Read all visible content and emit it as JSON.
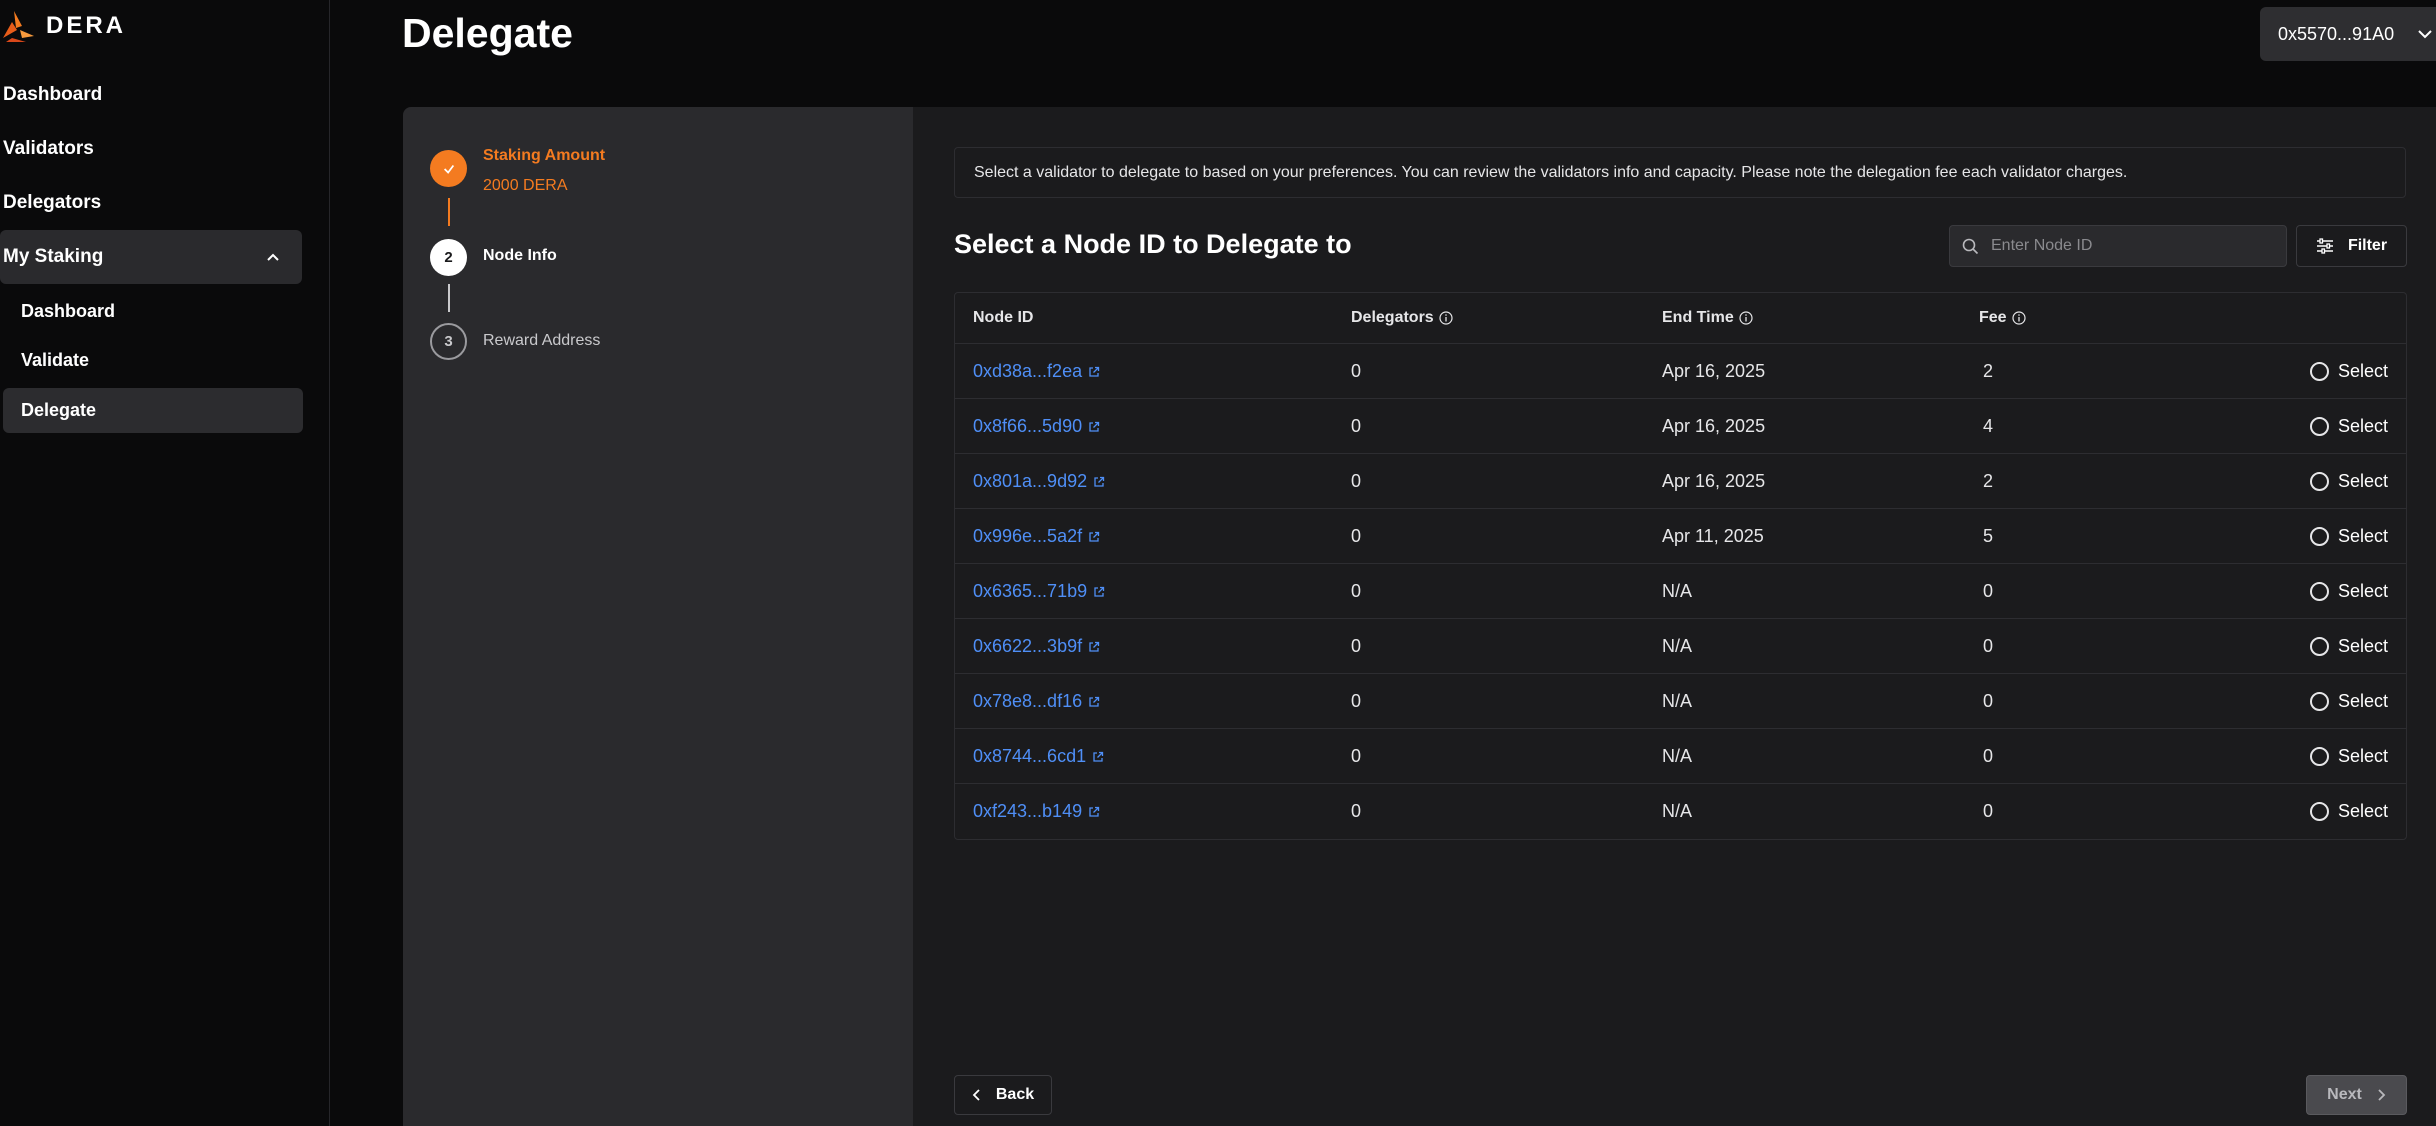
{
  "brand": {
    "name": "DERA",
    "accent": "#f47b20",
    "link_color": "#4f8ff7"
  },
  "sidebar": {
    "items": [
      {
        "label": "Dashboard"
      },
      {
        "label": "Validators"
      },
      {
        "label": "Delegators"
      },
      {
        "label": "My Staking"
      }
    ],
    "sub_items": [
      {
        "label": "Dashboard"
      },
      {
        "label": "Validate"
      },
      {
        "label": "Delegate"
      }
    ]
  },
  "header": {
    "title": "Delegate",
    "wallet": "0x5570...91A0"
  },
  "steps": [
    {
      "number": "",
      "title": "Staking Amount",
      "subtitle": "2000 DERA",
      "state": "done"
    },
    {
      "number": "2",
      "title": "Node Info",
      "state": "current"
    },
    {
      "number": "3",
      "title": "Reward Address",
      "state": "todo"
    }
  ],
  "main": {
    "info": "Select a validator to delegate to based on your preferences. You can review the validators info and capacity. Please note the delegation fee each validator charges.",
    "section_title": "Select a Node ID to Delegate to",
    "search_placeholder": "Enter Node ID",
    "filter_label": "Filter",
    "back_label": "Back",
    "next_label": "Next"
  },
  "table": {
    "columns": [
      "Node ID",
      "Delegators",
      "End Time",
      "Fee"
    ],
    "select_label": "Select",
    "rows": [
      {
        "node_id": "0xd38a...f2ea",
        "delegators": "0",
        "end_time": "Apr 16, 2025",
        "fee": "2"
      },
      {
        "node_id": "0x8f66...5d90",
        "delegators": "0",
        "end_time": "Apr 16, 2025",
        "fee": "4"
      },
      {
        "node_id": "0x801a...9d92",
        "delegators": "0",
        "end_time": "Apr 16, 2025",
        "fee": "2"
      },
      {
        "node_id": "0x996e...5a2f",
        "delegators": "0",
        "end_time": "Apr 11, 2025",
        "fee": "5"
      },
      {
        "node_id": "0x6365...71b9",
        "delegators": "0",
        "end_time": "N/A",
        "fee": "0"
      },
      {
        "node_id": "0x6622...3b9f",
        "delegators": "0",
        "end_time": "N/A",
        "fee": "0"
      },
      {
        "node_id": "0x78e8...df16",
        "delegators": "0",
        "end_time": "N/A",
        "fee": "0"
      },
      {
        "node_id": "0x8744...6cd1",
        "delegators": "0",
        "end_time": "N/A",
        "fee": "0"
      },
      {
        "node_id": "0xf243...b149",
        "delegators": "0",
        "end_time": "N/A",
        "fee": "0"
      }
    ]
  }
}
